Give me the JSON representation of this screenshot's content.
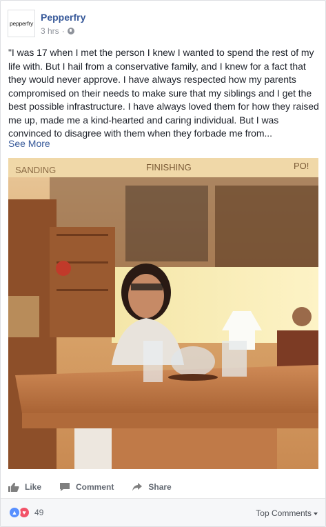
{
  "post": {
    "page_name": "Pepperfry",
    "logo_text": "pepperfry",
    "time": "3 hrs",
    "separator": "·",
    "privacy_icon": "globe-icon",
    "text": "\"I was 17 when I met the person I knew I wanted to spend the rest of my life with. But I hail from a conservative family, and I knew for a fact that they would never approve. I have always respected how my parents compromised on their needs to make sure that my siblings and I get the best possible infrastructure. I have always loved them for how they raised me up, made me a kind-hearted and caring individual. But I was convinced to disagree with them when they forbade me from...",
    "see_more": "See More"
  },
  "photo": {
    "wall_labels": [
      "SANDING",
      "FINISHING",
      "PO!"
    ]
  },
  "actions": {
    "like": "Like",
    "comment": "Comment",
    "share": "Share"
  },
  "footer": {
    "reaction_count": "49",
    "top_comments": "Top Comments"
  },
  "colors": {
    "link": "#365899",
    "like_blue": "#5890ff",
    "love_red": "#f25268"
  }
}
